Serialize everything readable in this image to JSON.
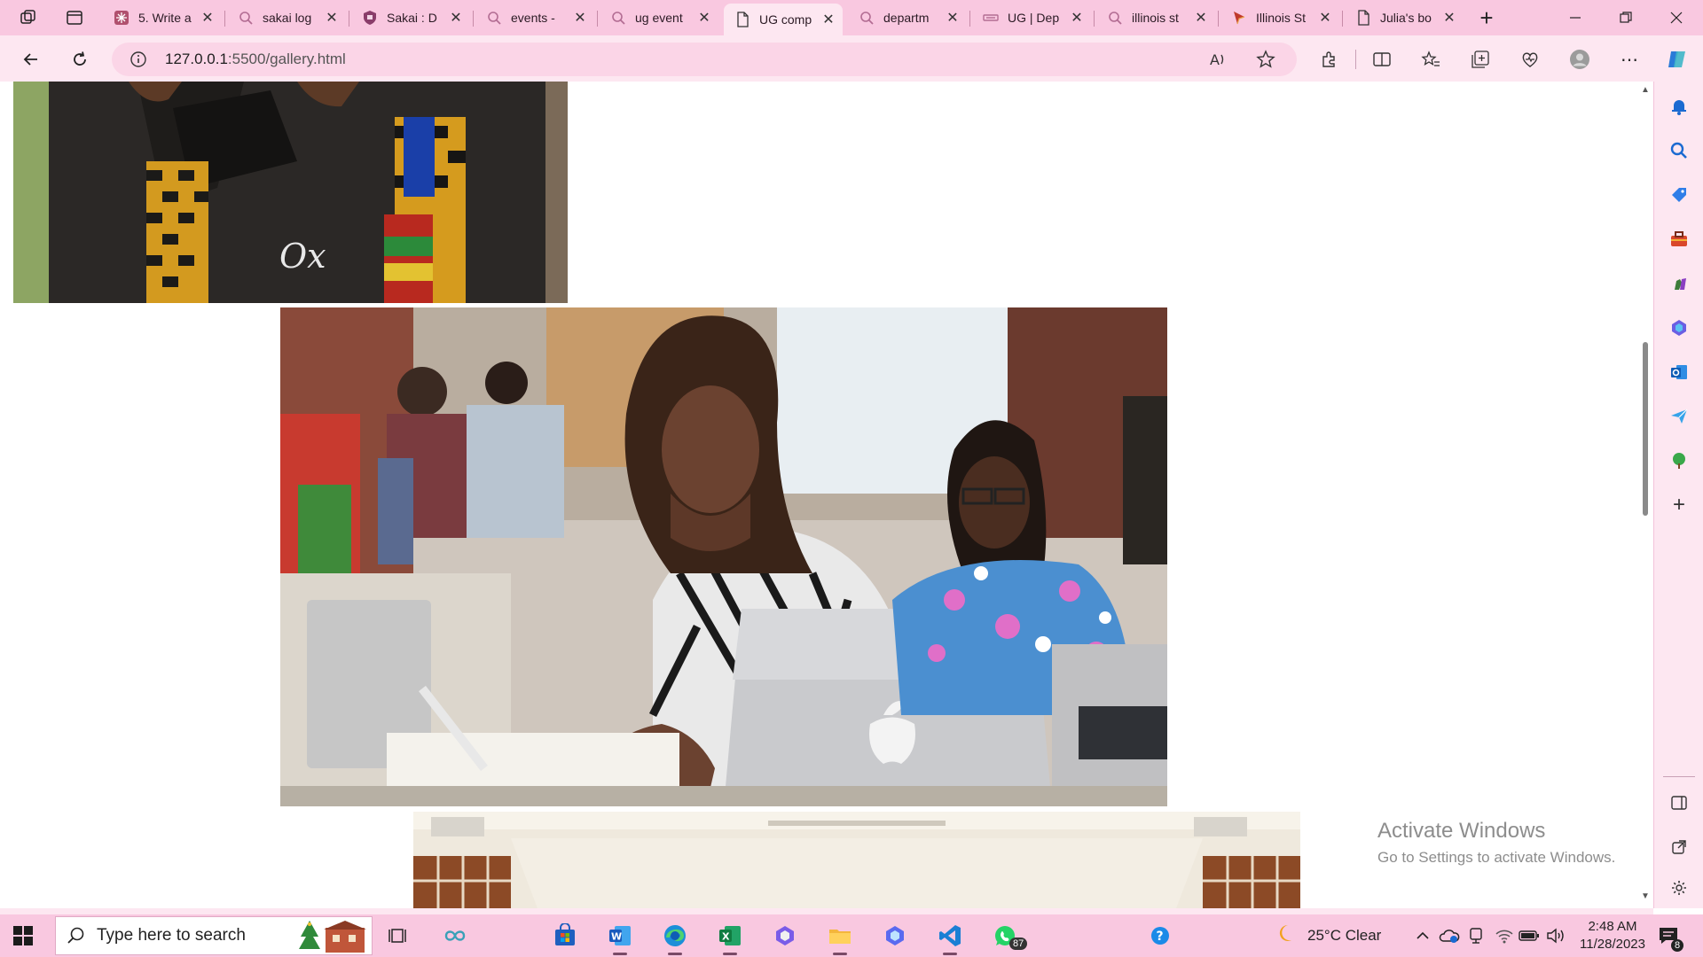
{
  "browser": {
    "tabs": [
      {
        "title": "5. Write a",
        "favicon": "sakai-icon"
      },
      {
        "title": "sakai log",
        "favicon": "search-icon"
      },
      {
        "title": "Sakai : D",
        "favicon": "shield-icon"
      },
      {
        "title": "events -",
        "favicon": "search-icon"
      },
      {
        "title": "ug event",
        "favicon": "search-icon"
      },
      {
        "title": "UG comp",
        "favicon": "page-icon",
        "active": true
      },
      {
        "title": "departm",
        "favicon": "search-icon"
      },
      {
        "title": "UG | Dep",
        "favicon": "ug-icon"
      },
      {
        "title": "illinois st",
        "favicon": "search-icon"
      },
      {
        "title": "Illinois St",
        "favicon": "bookmark-icon"
      },
      {
        "title": "Julia's bo",
        "favicon": "page-icon"
      }
    ],
    "url_host": "127.0.0.1",
    "url_path": ":5500/gallery.html",
    "new_tab_label": "+"
  },
  "page": {
    "images": [
      {
        "name": "graduates-kente-stoles",
        "desc_colors": [
          "#2a2622",
          "#e0a21e",
          "#1a1a1a",
          "#3a7a3a"
        ]
      },
      {
        "name": "students-with-laptops"
      },
      {
        "name": "classroom-interior"
      }
    ],
    "watermark": {
      "line1": "Activate Windows",
      "line2": "Go to Settings to activate Windows."
    }
  },
  "taskbar": {
    "search_placeholder": "Type here to search",
    "weather": "25°C  Clear",
    "time": "2:48 AM",
    "date": "11/28/2023",
    "whatsapp_badge": "87",
    "notification_badge": "8"
  },
  "colors": {
    "chrome_pink": "#f9c8e0",
    "toolbar_pink": "#fde7f1",
    "omnibox_pink": "#fbd5e7"
  }
}
